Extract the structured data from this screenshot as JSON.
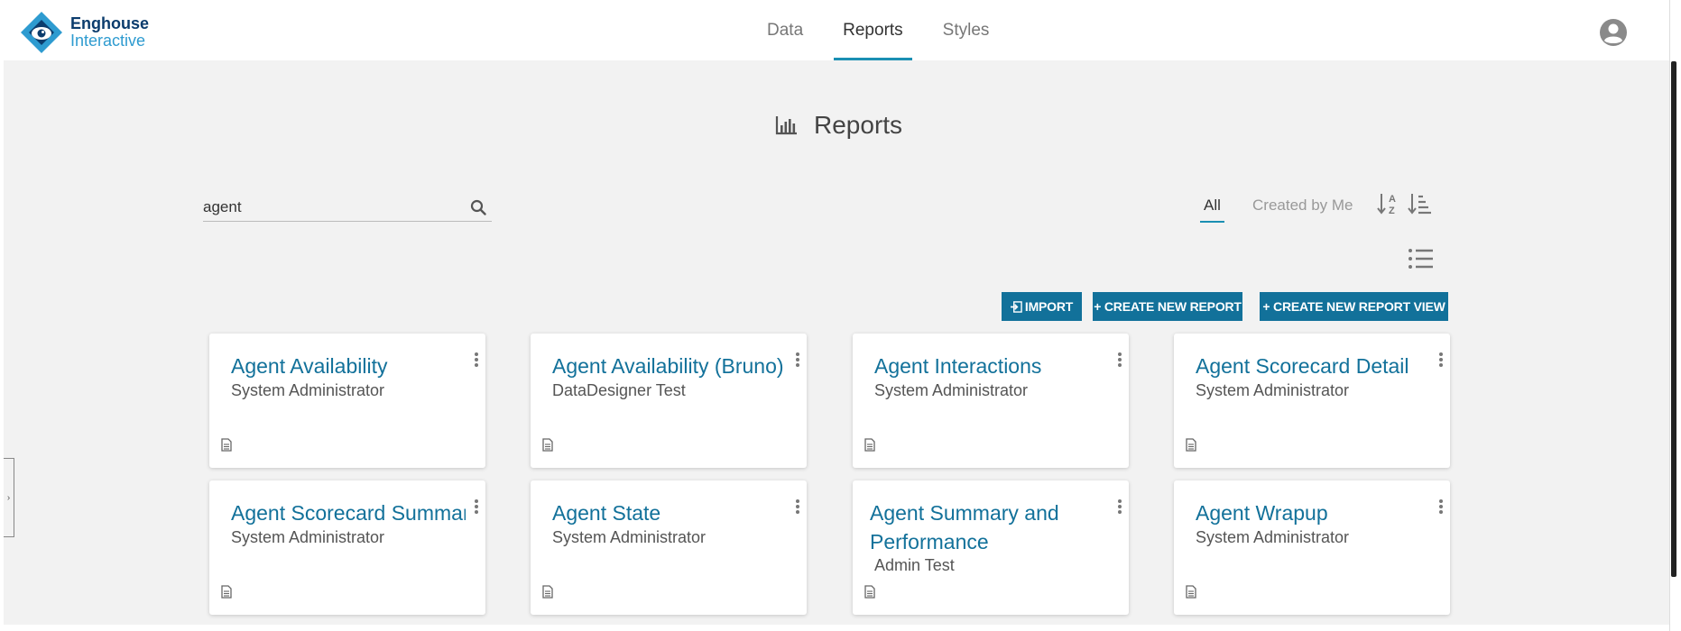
{
  "brand": {
    "line1": "Enghouse",
    "line2": "Interactive"
  },
  "nav": {
    "tabs": [
      "Data",
      "Reports",
      "Styles"
    ],
    "active": "Reports"
  },
  "page": {
    "title": "Reports"
  },
  "search": {
    "value": "agent",
    "placeholder": ""
  },
  "filters": {
    "all": "All",
    "created_by_me": "Created by Me",
    "active": "All"
  },
  "actions": {
    "import": "IMPORT",
    "create_report": "+ CREATE NEW REPORT",
    "create_report_view": "+ CREATE NEW REPORT VIEW"
  },
  "reports": [
    {
      "title": "Agent Availability",
      "owner": "System Administrator"
    },
    {
      "title": "Agent Availability (Bruno)",
      "owner": "DataDesigner Test"
    },
    {
      "title": "Agent Interactions",
      "owner": "System Administrator"
    },
    {
      "title": "Agent Scorecard Detail",
      "owner": "System Administrator"
    },
    {
      "title": "Agent Scorecard Summary",
      "owner": "System Administrator"
    },
    {
      "title": "Agent State",
      "owner": "System Administrator"
    },
    {
      "title": "Agent Summary and Performance",
      "owner": "Admin Test"
    },
    {
      "title": "Agent Wrapup",
      "owner": "System Administrator"
    }
  ],
  "colors": {
    "accent": "#12719a",
    "background": "#f2f2f2",
    "tab_underline": "#1a8fb3"
  },
  "icons": {
    "logo": "enghouse-eye-logo",
    "user": "user-circle-icon",
    "title": "bar-chart-icon",
    "search": "search-icon",
    "sort_alpha": "sort-alpha-icon",
    "sort_list": "sort-amount-icon",
    "list_view": "list-view-icon",
    "card_menu": "more-vertical-icon",
    "card_type": "document-icon"
  }
}
